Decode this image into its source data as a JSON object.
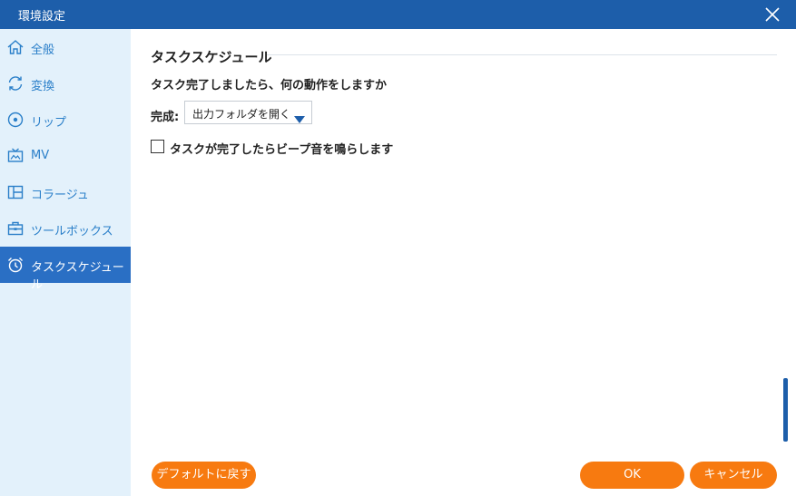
{
  "window": {
    "title": "環境設定"
  },
  "sidebar": {
    "items": [
      {
        "label": "全般",
        "icon": "home-icon",
        "active": false
      },
      {
        "label": "変換",
        "icon": "convert-icon",
        "active": false
      },
      {
        "label": "リップ",
        "icon": "disc-icon",
        "active": false
      },
      {
        "label": "MV",
        "icon": "tv-icon",
        "active": false
      },
      {
        "label": "コラージュ",
        "icon": "collage-icon",
        "active": false
      },
      {
        "label": "ツールボックス",
        "icon": "toolbox-icon",
        "active": false
      },
      {
        "label": "タスクスケジュール",
        "icon": "alarm-clock-icon",
        "active": true
      }
    ]
  },
  "main": {
    "section_title": "タスクスケジュール",
    "question": "タスク完了しましたら、何の動作をしますか",
    "done_label": "完成:",
    "done_value": "出力フォルダを開く",
    "beep_label": "タスクが完了したらビープ音を鳴らします",
    "beep_checked": false
  },
  "buttons": {
    "default": "デフォルトに戻す",
    "ok": "OK",
    "cancel": "キャンセル"
  },
  "colors": {
    "titlebar": "#1d5eaa",
    "sidebar": "#e3f1fb",
    "active_item": "#2a6fc4",
    "nav_text": "#2a7fc9",
    "button": "#f77a10"
  }
}
